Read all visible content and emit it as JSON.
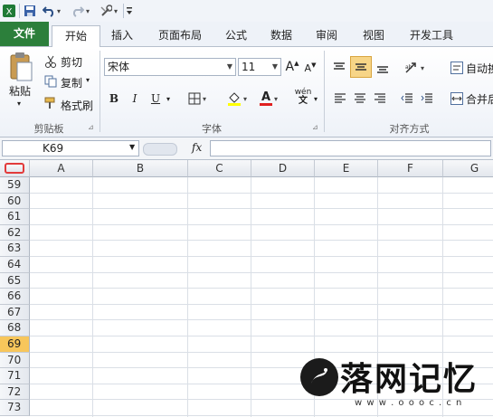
{
  "quick_access": {
    "save_icon": "save-icon",
    "undo_icon": "undo-icon",
    "redo_icon": "redo-icon",
    "customize_icon": "customize-icon"
  },
  "tabs": [
    {
      "label": "文件"
    },
    {
      "label": "开始"
    },
    {
      "label": "插入"
    },
    {
      "label": "页面布局"
    },
    {
      "label": "公式"
    },
    {
      "label": "数据"
    },
    {
      "label": "审阅"
    },
    {
      "label": "视图"
    },
    {
      "label": "开发工具"
    }
  ],
  "ribbon": {
    "clipboard": {
      "paste_label": "粘贴",
      "cut_label": "剪切",
      "copy_label": "复制",
      "format_painter_label": "格式刷",
      "group_label": "剪贴板"
    },
    "font": {
      "font_name": "宋体",
      "font_size": "11",
      "bold": "B",
      "italic": "I",
      "underline": "U",
      "grow": "A",
      "shrink": "A",
      "font_color_letter": "A",
      "phonetic": "wén",
      "group_label": "字体"
    },
    "alignment": {
      "wrap_label": "自动换",
      "merge_label": "合并后",
      "group_label": "对齐方式"
    }
  },
  "formula_bar": {
    "name_box": "K69",
    "fx": "fx",
    "formula": ""
  },
  "sheet": {
    "columns": [
      "A",
      "B",
      "C",
      "D",
      "E",
      "F",
      "G"
    ],
    "rows": [
      "59",
      "60",
      "61",
      "62",
      "63",
      "64",
      "65",
      "66",
      "67",
      "68",
      "69",
      "70",
      "71",
      "72",
      "73"
    ],
    "active_row": "69"
  },
  "watermark": {
    "text": "落网记忆",
    "url": "w w w . o o o c . c n"
  },
  "colors": {
    "file_tab": "#2c7f3b",
    "active_row_header": "#f7c65b",
    "ribbon_bg": "#eef2f8"
  }
}
